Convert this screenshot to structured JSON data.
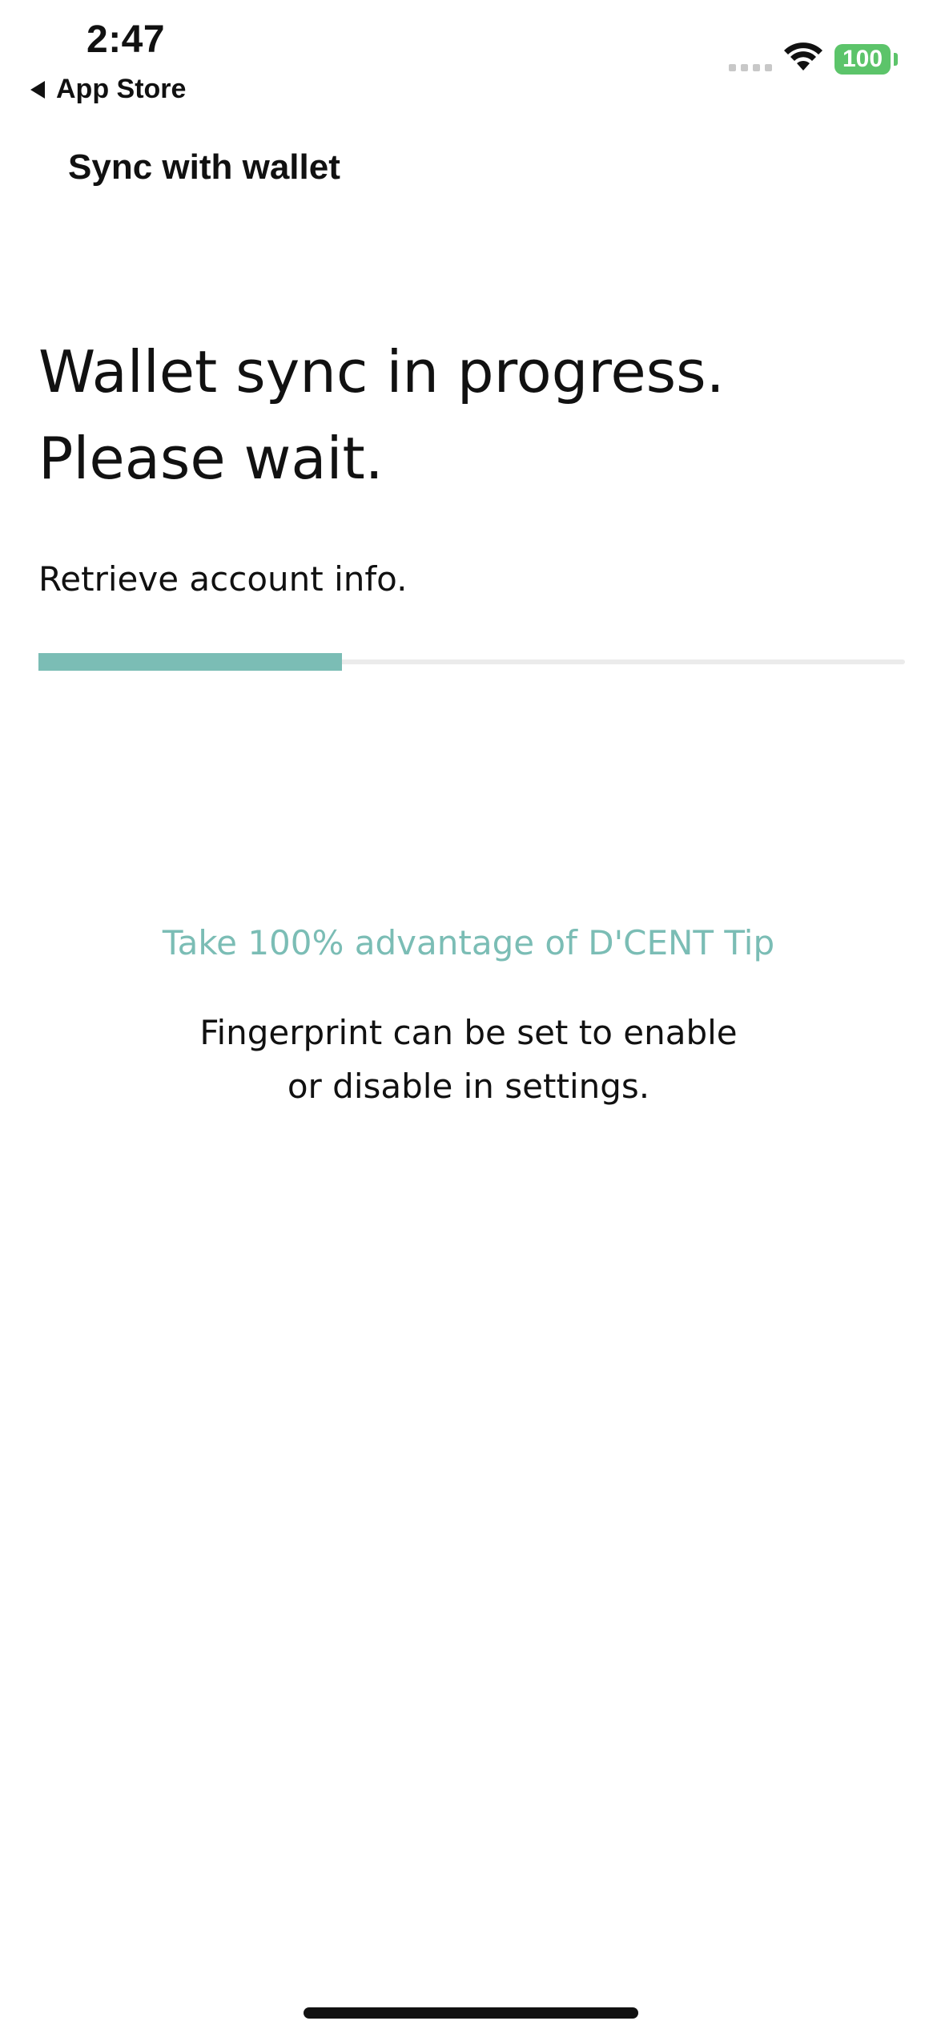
{
  "status_bar": {
    "time": "2:47",
    "back_app": "App Store",
    "battery_level": "100"
  },
  "nav": {
    "title": "Sync with wallet"
  },
  "main": {
    "heading_line1": "Wallet sync in progress.",
    "heading_line2": "Please wait.",
    "step_text": "Retrieve account info.",
    "progress_fraction": 0.35
  },
  "tip": {
    "title": "Take 100% advantage of D'CENT Tip",
    "body_line1": "Fingerprint can be set to enable",
    "body_line2": "or disable in settings."
  },
  "colors": {
    "accent": "#7bbdb5",
    "battery": "#5cc46a",
    "track": "#ebebeb"
  }
}
